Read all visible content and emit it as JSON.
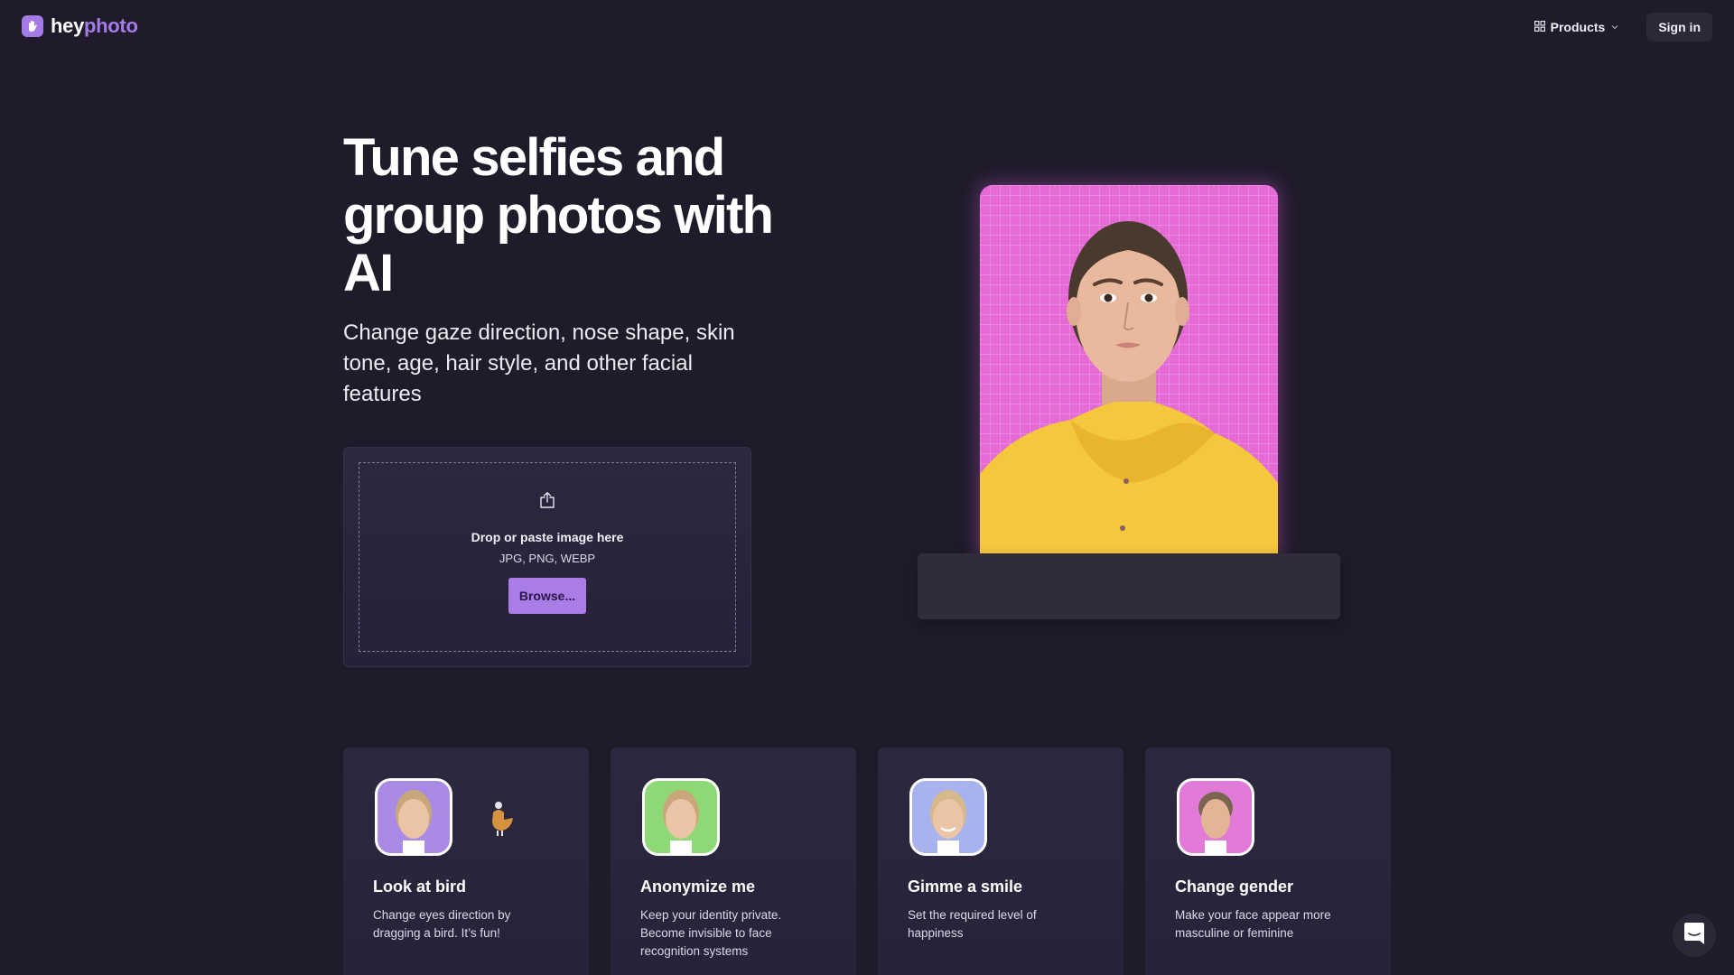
{
  "brand": {
    "name_part1": "hey",
    "name_part2": "photo",
    "logo_icon": "waving-hand-icon",
    "accent_color": "#a57be8"
  },
  "nav": {
    "products_label": "Products",
    "products_icon": "grid-icon",
    "products_chevron": "chevron-down-icon",
    "signin_label": "Sign in"
  },
  "hero": {
    "title": "Tune selfies and group photos with AI",
    "subtitle": "Change gaze direction, nose shape, skin tone, age, hair style, and other facial features"
  },
  "upload": {
    "icon": "upload-share-icon",
    "title": "Drop or paste image here",
    "formats": "JPG, PNG, WEBP",
    "browse_label": "Browse..."
  },
  "showcase": {
    "image": "woman-in-yellow-jacket-portrait",
    "background_color": "#e56ad6",
    "jacket_color": "#f5c73d"
  },
  "features": [
    {
      "title": "Look at bird",
      "description": "Change eyes direction by dragging a bird. It’s fun!",
      "thumb_color": "#a98be6",
      "has_bird": true
    },
    {
      "title": "Anonymize me",
      "description": "Keep your identity private. Become invisible to face recognition systems",
      "thumb_color": "#8ed876",
      "has_bird": false
    },
    {
      "title": "Gimme a smile",
      "description": "Set the required level of happiness",
      "thumb_color": "#a7b2ee",
      "has_bird": false
    },
    {
      "title": "Change gender",
      "description": "Make your face appear more masculine or feminine",
      "thumb_color": "#e27ad8",
      "has_bird": false
    }
  ],
  "chat": {
    "icon": "chat-bubble-icon"
  }
}
